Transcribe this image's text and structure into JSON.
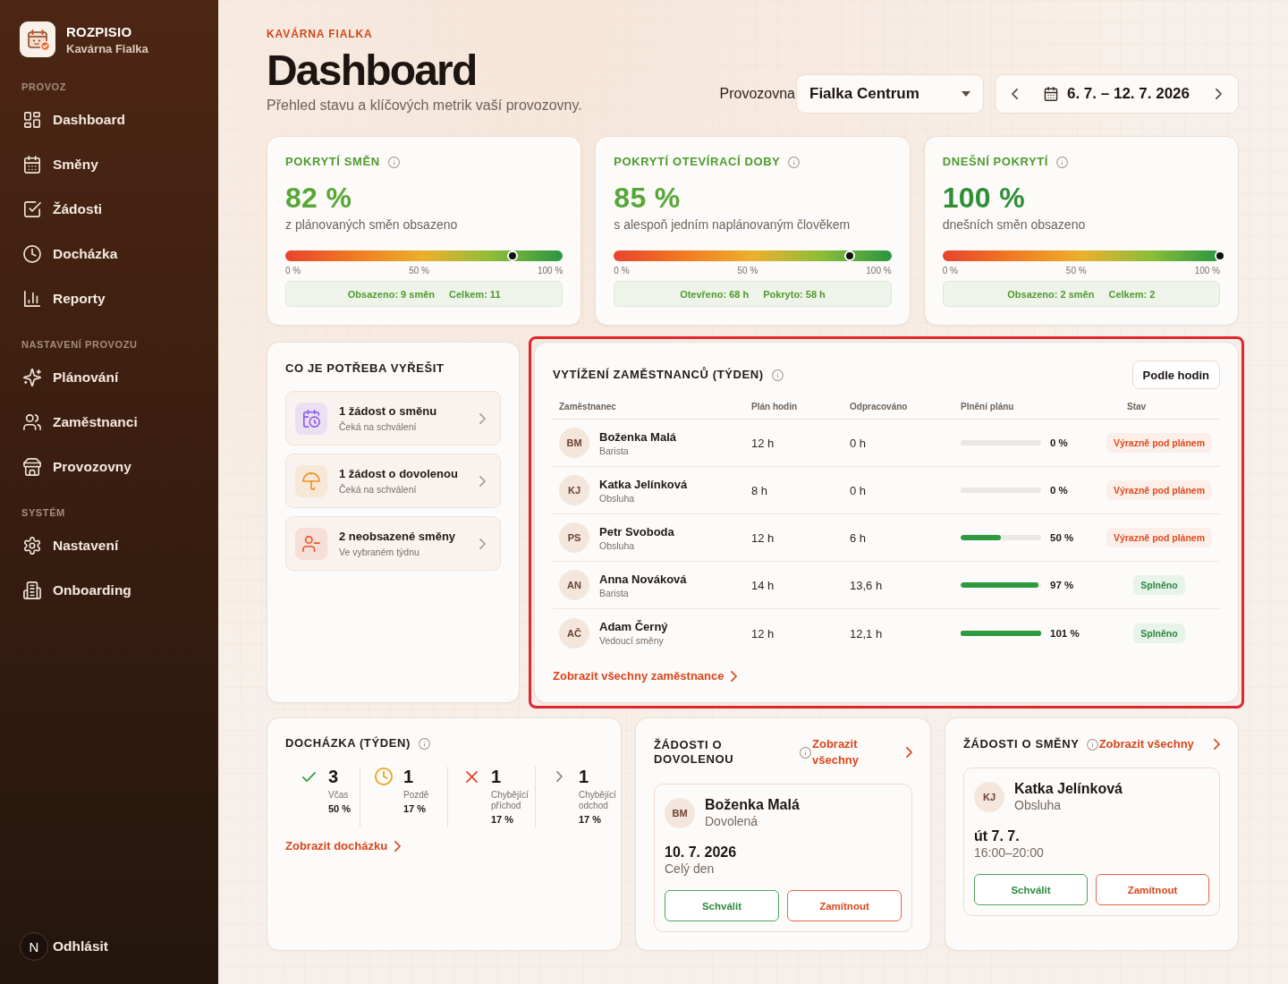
{
  "sidebar": {
    "brand": {
      "name": "ROZPISIO",
      "subtitle": "Kavárna Fialka"
    },
    "sections": [
      {
        "title": "PROVOZ",
        "items": [
          "Dashboard",
          "Směny",
          "Žádosti",
          "Docházka",
          "Reporty"
        ]
      },
      {
        "title": "NASTAVENÍ PROVOZU",
        "items": [
          "Plánování",
          "Zaměstnanci",
          "Provozovny"
        ]
      },
      {
        "title": "SYSTÉM",
        "items": [
          "Nastavení",
          "Onboarding"
        ]
      }
    ],
    "footer": {
      "badge": "N",
      "logout": "Odhlásit"
    }
  },
  "header": {
    "eyebrow": "KAVÁRNA FIALKA",
    "title": "Dashboard",
    "subtitle": "Přehled stavu a klíčových metrik vaší provozovny.",
    "location_label": "Provozovna",
    "location": "Fialka Centrum",
    "date_range": "6. 7. – 12. 7. 2026"
  },
  "metrics": [
    {
      "title": "POKRYTÍ SMĚN",
      "value": "82 %",
      "color": "#57a737",
      "caption": "z plánovaných směn obsazeno",
      "level": 0.82,
      "scale": [
        "0 %",
        "50 %",
        "100 %"
      ],
      "summary": [
        "Obsazeno: 9 směn",
        "Celkem: 11"
      ]
    },
    {
      "title": "POKRYTÍ OTEVÍRACÍ DOBY",
      "value": "85 %",
      "color": "#57a737",
      "caption": "s alespoň jedním naplánovaným člověkem",
      "level": 0.85,
      "scale": [
        "0 %",
        "50 %",
        "100 %"
      ],
      "summary": [
        "Otevřeno: 68 h",
        "Pokryto: 58 h"
      ]
    },
    {
      "title": "DNEŠNÍ POKRYTÍ",
      "value": "100 %",
      "color": "#2e8f36",
      "caption": "dnešních směn obsazeno",
      "level": 1,
      "scale": [
        "0 %",
        "50 %",
        "100 %"
      ],
      "summary": [
        "Obsazeno: 2 směn",
        "Celkem: 2"
      ]
    }
  ],
  "todo": {
    "title": "CO JE POTŘEBA VYŘEŠIT",
    "items": [
      {
        "title": "1 žádost o směnu",
        "subtitle": "Čeká na schválení",
        "color": "#8b5cf6"
      },
      {
        "title": "1 žádost o dovolenou",
        "subtitle": "Čeká na schválení",
        "color": "#f0901e"
      },
      {
        "title": "2 neobsazené směny",
        "subtitle": "Ve vybraném týdnu",
        "color": "#e8542a"
      }
    ]
  },
  "workload": {
    "title": "VYTÍŽENÍ ZAMĚSTNANCŮ (TÝDEN)",
    "highlighted": true,
    "sort_button": "Podle hodin",
    "columns": [
      "Zaměstnanec",
      "Plán hodin",
      "Odpracováno",
      "Plnění plánu",
      "Stav"
    ],
    "rows": [
      {
        "initials": "BM",
        "name": "Boženka Malá",
        "role": "Barista",
        "planned": "12 h",
        "worked": "0 h",
        "level": 0,
        "percent": "0 %",
        "status": "Výrazně pod plánem",
        "kind": "under"
      },
      {
        "initials": "KJ",
        "name": "Katka Jelínková",
        "role": "Obsluha",
        "planned": "8 h",
        "worked": "0 h",
        "level": 0,
        "percent": "0 %",
        "status": "Výrazně pod plánem",
        "kind": "under"
      },
      {
        "initials": "PS",
        "name": "Petr Svoboda",
        "role": "Obsluha",
        "planned": "12 h",
        "worked": "6 h",
        "level": 0.5,
        "percent": "50 %",
        "status": "Výrazně pod plánem",
        "kind": "under"
      },
      {
        "initials": "AN",
        "name": "Anna Nováková",
        "role": "Barista",
        "planned": "14 h",
        "worked": "13,6 h",
        "level": 0.97,
        "percent": "97 %",
        "status": "Splněno",
        "kind": "done"
      },
      {
        "initials": "AČ",
        "name": "Adam Černý",
        "role": "Vedoucí směny",
        "planned": "12 h",
        "worked": "12,1 h",
        "level": 1,
        "percent": "101 %",
        "status": "Splněno",
        "kind": "done"
      }
    ],
    "link": "Zobrazit všechny zaměstnance"
  },
  "attendance": {
    "title": "DOCHÁZKA (TÝDEN)",
    "stats": [
      {
        "kind": "on_time",
        "count": "3",
        "label": "Včas",
        "percent": "50 %"
      },
      {
        "kind": "late",
        "count": "1",
        "label": "Pozdě",
        "percent": "17 %"
      },
      {
        "kind": "missing_in",
        "count": "1",
        "label": "Chybějící příchod",
        "percent": "17 %"
      },
      {
        "kind": "missing_out",
        "count": "1",
        "label": "Chybějící odchod",
        "percent": "17 %"
      }
    ],
    "link": "Zobrazit docházku"
  },
  "leave_requests": {
    "title": "ŽÁDOSTI O DOVOLENOU",
    "link": "Zobrazit všechny",
    "request": {
      "initials": "BM",
      "name": "Boženka Malá",
      "type": "Dovolená",
      "date": "10. 7. 2026",
      "time": "Celý den",
      "actions": [
        {
          "label": "Schválit",
          "kind": "approve"
        },
        {
          "label": "Zamítnout",
          "kind": "reject"
        }
      ]
    }
  },
  "shift_requests": {
    "title": "ŽÁDOSTI O SMĚNY",
    "link": "Zobrazit všechny",
    "request": {
      "initials": "KJ",
      "name": "Katka Jelínková",
      "type": "Obsluha",
      "date": "út 7. 7.",
      "time": "16:00–20:00",
      "actions": [
        {
          "label": "Schválit",
          "kind": "approve"
        },
        {
          "label": "Zamítnout",
          "kind": "reject"
        }
      ]
    }
  }
}
